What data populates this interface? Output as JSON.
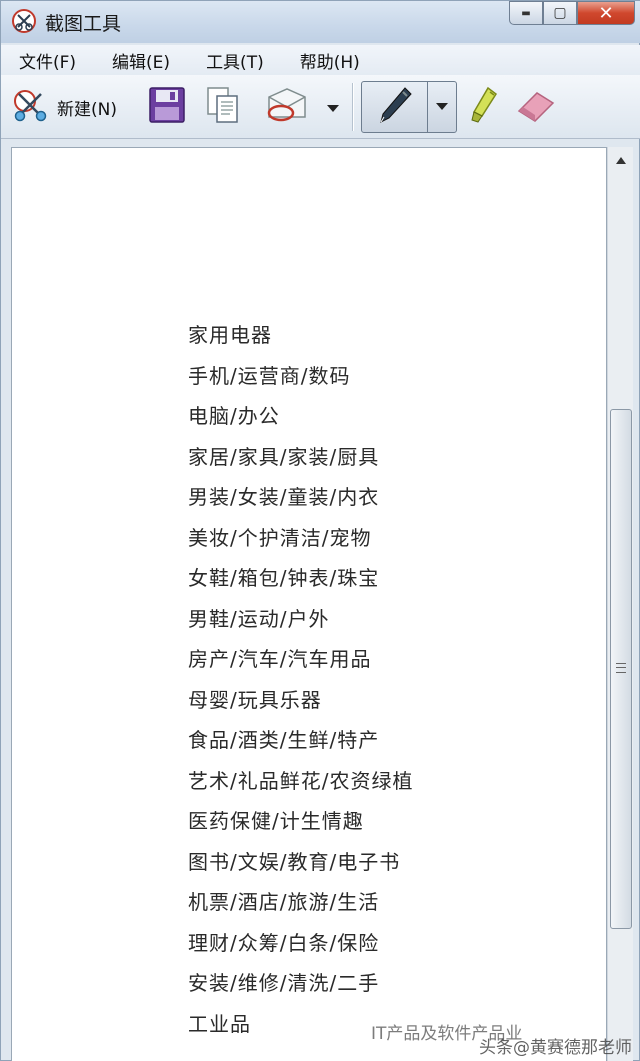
{
  "window": {
    "title": "截图工具",
    "minimize_glyph": "▬",
    "maximize_glyph": "▢",
    "close_glyph": "✕"
  },
  "menu": {
    "items": [
      {
        "label": "文件(F)"
      },
      {
        "label": "编辑(E)"
      },
      {
        "label": "工具(T)"
      },
      {
        "label": "帮助(H)"
      }
    ]
  },
  "toolbar": {
    "new_label": "新建(N)",
    "icons": [
      "scissors-icon",
      "save-icon",
      "copy-icon",
      "send-email-icon",
      "dropdown-arrow-icon",
      "pen-icon",
      "highlighter-icon",
      "eraser-icon"
    ]
  },
  "content": {
    "items": [
      "家用电器",
      "手机/运营商/数码",
      "电脑/办公",
      "家居/家具/家装/厨具",
      "男装/女装/童装/内衣",
      "美妆/个护清洁/宠物",
      "女鞋/箱包/钟表/珠宝",
      "男鞋/运动/户外",
      "房产/汽车/汽车用品",
      "母婴/玩具乐器",
      "食品/酒类/生鲜/特产",
      "艺术/礼品鲜花/农资绿植",
      "医药保健/计生情趣",
      "图书/文娱/教育/电子书",
      "机票/酒店/旅游/生活",
      "理财/众筹/白条/保险",
      "安装/维修/清洗/二手",
      "工业品"
    ]
  },
  "watermark": {
    "line1": "IT产品及软件产品业",
    "line2": "头条@黄赛德那老师"
  },
  "colors": {
    "close_red": "#c94a2f",
    "titlebar_blue": "#c9d8ea",
    "content_bg": "#ffffff"
  }
}
